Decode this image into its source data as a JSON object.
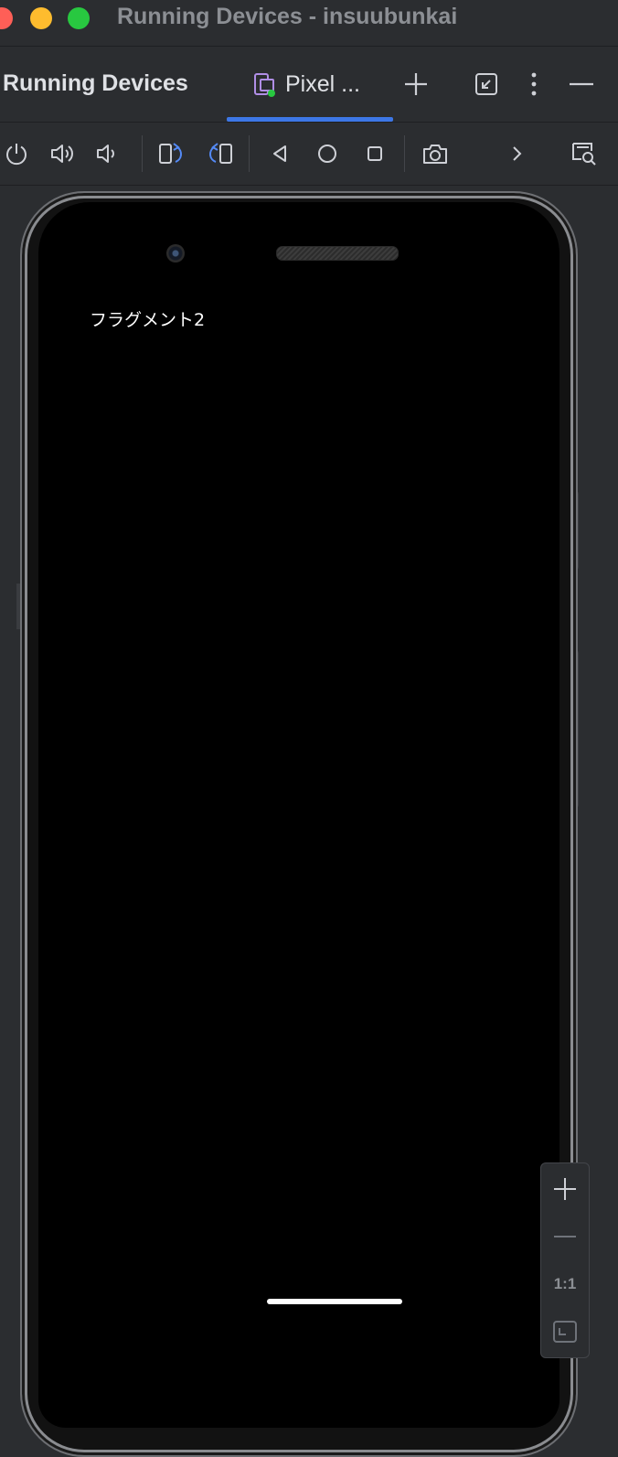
{
  "window": {
    "title": "Running Devices - insuubunkai"
  },
  "tool_window": {
    "title": "Running Devices",
    "device_tab_label": "Pixel ...",
    "icons": [
      "device-status-icon",
      "add-icon",
      "restore-icon",
      "more-icon",
      "minimize-icon"
    ]
  },
  "toolbar": {
    "icons": [
      "power-icon",
      "volume-up-icon",
      "volume-down-icon",
      "rotate-left-icon",
      "rotate-right-icon",
      "back-icon",
      "home-icon",
      "overview-icon",
      "camera-icon",
      "chevron-right-icon",
      "screen-search-icon"
    ]
  },
  "device_screen": {
    "app_text": "フラグメント2"
  },
  "zoom": {
    "actual_size_label": "1:1",
    "icons": [
      "zoom-in-icon",
      "zoom-out-icon",
      "fit-screen-icon"
    ]
  },
  "colors": {
    "accent": "#3d77e6",
    "background": "#2b2d30",
    "status_green": "#28c840"
  }
}
